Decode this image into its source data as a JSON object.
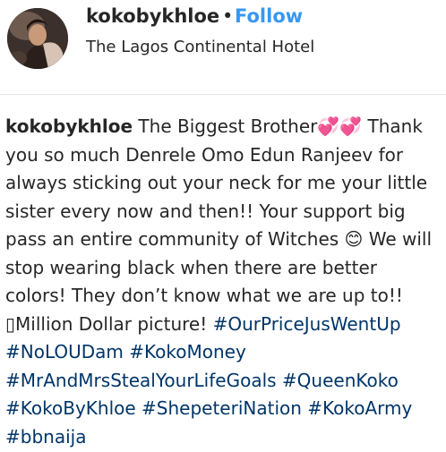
{
  "post": {
    "username": "kokobykhloe",
    "separator": "•",
    "follow_label": "Follow",
    "location": "The Lagos Continental Hotel"
  },
  "caption": {
    "username": "kokobykhloe",
    "text_1": " The Biggest Brother",
    "hearts": "💞💞",
    "text_2": " Thank you so much Denrele Omo Edun Ranjeev for always sticking out your neck for me your little sister every now and then!! Your support big pass an entire community of Witches ",
    "smile": "😊",
    "text_3": " We will stop wearing black when there are better colors! They don’t know what we are up to!! ",
    "unknown_glyph": "▯",
    "text_4": "Million Dollar picture! ",
    "hashtags": [
      "#OurPriceJusWentUp",
      "#NoLOUDam",
      "#KokoMoney",
      "#MrAndMrsStealYourLifeGoals",
      "#QueenKoko",
      "#KokoByKhloe",
      "#ShepeteriNation",
      "#KokoArmy",
      "#bbnaija"
    ]
  },
  "colors": {
    "follow": "#3897f0",
    "hashtag": "#003569",
    "text": "#262626",
    "divider": "#e6e6e6"
  }
}
